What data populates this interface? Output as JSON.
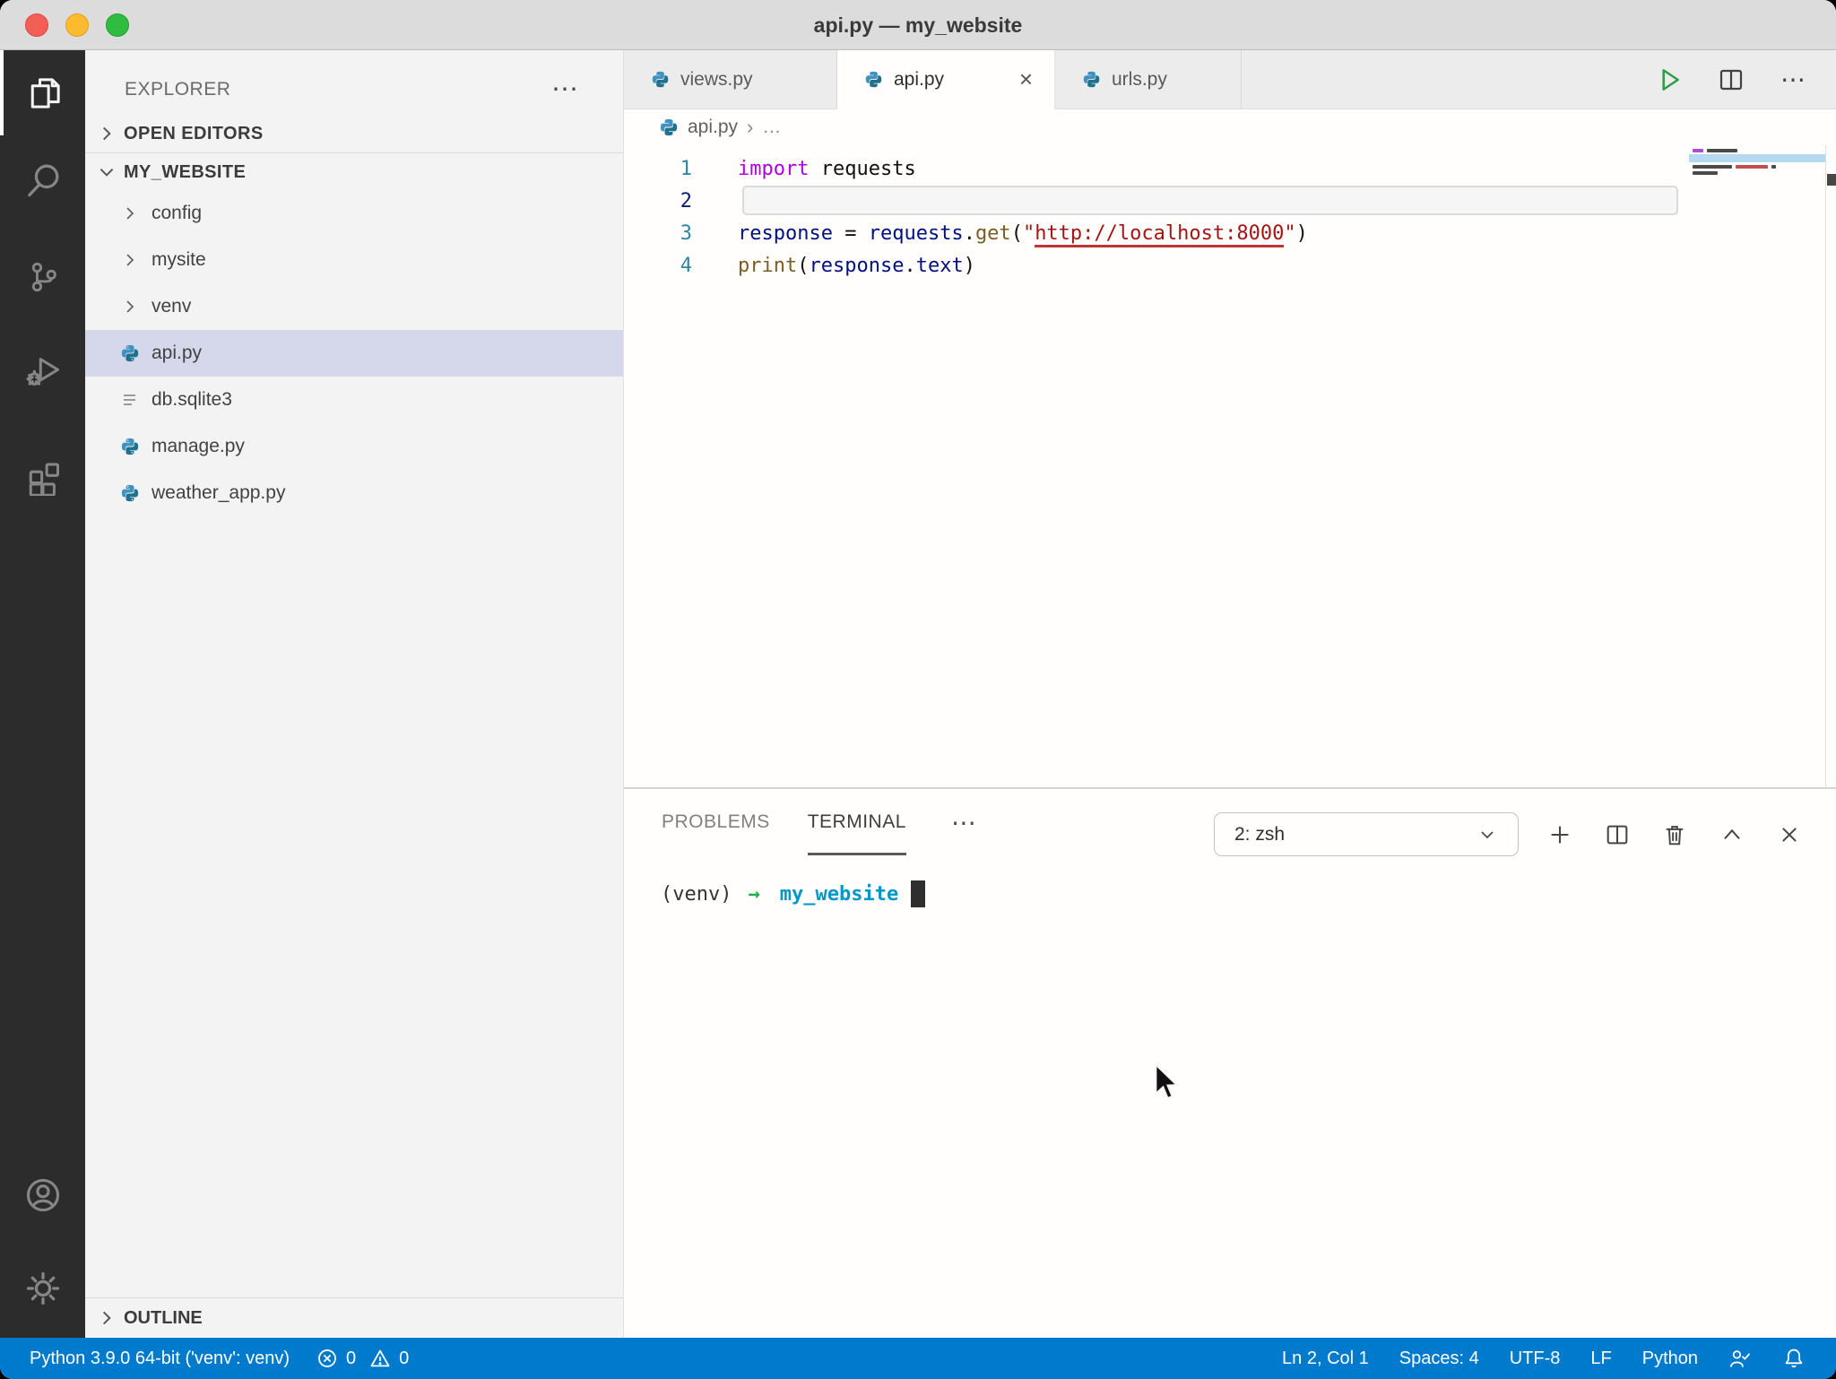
{
  "window": {
    "title": "api.py — my_website"
  },
  "activity_bar": {
    "items": [
      {
        "id": "explorer",
        "icon": "files-icon",
        "active": true
      },
      {
        "id": "search",
        "icon": "search-icon",
        "active": false
      },
      {
        "id": "source-control",
        "icon": "source-control-icon",
        "active": false
      },
      {
        "id": "run-debug",
        "icon": "run-debug-icon",
        "active": false
      },
      {
        "id": "extensions",
        "icon": "extensions-icon",
        "active": false
      }
    ],
    "bottom_items": [
      {
        "id": "accounts",
        "icon": "account-icon"
      },
      {
        "id": "settings",
        "icon": "gear-icon"
      }
    ]
  },
  "sidebar": {
    "title": "EXPLORER",
    "more": "⋯",
    "open_editors": {
      "label": "OPEN EDITORS"
    },
    "root": {
      "label": "MY_WEBSITE"
    },
    "tree": [
      {
        "label": "config",
        "kind": "folder"
      },
      {
        "label": "mysite",
        "kind": "folder"
      },
      {
        "label": "venv",
        "kind": "folder"
      },
      {
        "label": "api.py",
        "kind": "python-file",
        "selected": true
      },
      {
        "label": "db.sqlite3",
        "kind": "database-file"
      },
      {
        "label": "manage.py",
        "kind": "python-file"
      },
      {
        "label": "weather_app.py",
        "kind": "python-file"
      }
    ],
    "outline": {
      "label": "OUTLINE"
    }
  },
  "editor": {
    "tabs": [
      {
        "label": "views.py",
        "active": false
      },
      {
        "label": "api.py",
        "active": true,
        "close": "×"
      },
      {
        "label": "urls.py",
        "active": false
      }
    ],
    "breadcrumb": {
      "file": "api.py",
      "separator": "›",
      "more": "…"
    },
    "code": {
      "language": "python",
      "active_line": 2,
      "lines": [
        {
          "num": "1",
          "tokens": [
            {
              "text": "import",
              "type": "keyword"
            },
            {
              "text": " requests",
              "type": "plain"
            }
          ]
        },
        {
          "num": "2",
          "tokens": []
        },
        {
          "num": "3",
          "tokens": [
            {
              "text": "response",
              "type": "variable"
            },
            {
              "text": " = ",
              "type": "plain"
            },
            {
              "text": "requests",
              "type": "variable"
            },
            {
              "text": ".",
              "type": "plain"
            },
            {
              "text": "get",
              "type": "function"
            },
            {
              "text": "(",
              "type": "plain"
            },
            {
              "text": "\"",
              "type": "string"
            },
            {
              "text": "http://localhost:8000",
              "type": "string-link"
            },
            {
              "text": "\"",
              "type": "string"
            },
            {
              "text": ")",
              "type": "plain"
            }
          ]
        },
        {
          "num": "4",
          "tokens": [
            {
              "text": "print",
              "type": "function"
            },
            {
              "text": "(",
              "type": "plain"
            },
            {
              "text": "response",
              "type": "variable"
            },
            {
              "text": ".",
              "type": "plain"
            },
            {
              "text": "text",
              "type": "variable"
            },
            {
              "text": ")",
              "type": "plain"
            }
          ]
        }
      ]
    }
  },
  "panel": {
    "tabs": [
      {
        "label": "PROBLEMS",
        "active": false
      },
      {
        "label": "TERMINAL",
        "active": true
      }
    ],
    "more": "⋯",
    "shell_select": {
      "value": "2: zsh"
    },
    "terminal": {
      "prompt_venv": "(venv)",
      "prompt_arrow": "→",
      "prompt_path": "my_website"
    }
  },
  "status_bar": {
    "interpreter": "Python 3.9.0 64-bit ('venv': venv)",
    "problems": {
      "errors": "0",
      "warnings": "0"
    },
    "right_items": [
      "Ln 2, Col 1",
      "Spaces: 4",
      "UTF-8",
      "LF",
      "Python"
    ]
  },
  "colors": {
    "accent": "#007acc",
    "activity_bar": "#2c2c2c",
    "sidebar": "#f3f3f3",
    "selection_row": "#d4d8ea",
    "keyword": "#af00db",
    "string": "#a31515",
    "function": "#795e26",
    "variable": "#001080",
    "terminal_path": "#0099c7",
    "terminal_arrow": "#1fb24a",
    "run_button": "#2da042",
    "python_icon_top": "#4292c0",
    "python_icon_bottom": "#20708f"
  }
}
